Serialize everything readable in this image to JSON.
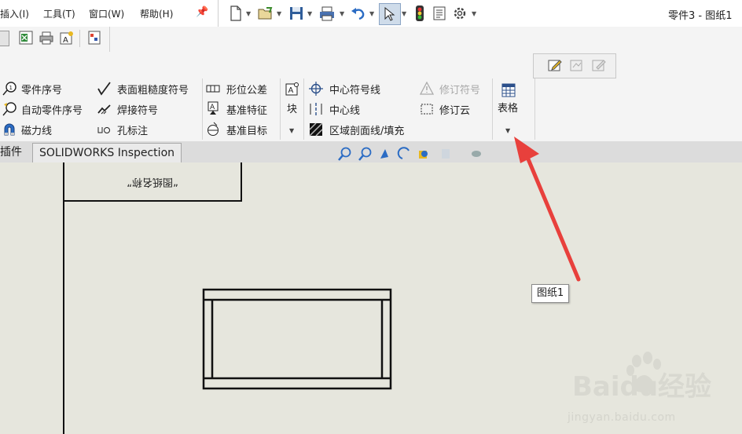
{
  "menu": {
    "insert": "插入(I)",
    "tools": "工具(T)",
    "window": "窗口(W)",
    "help": "帮助(H)"
  },
  "window_title": "零件3 - 图纸1",
  "ribbon": {
    "col1": [
      "零件序号",
      "自动零件序号",
      "磁力线"
    ],
    "col2": [
      "表面粗糙度符号",
      "焊接符号",
      "孔标注"
    ],
    "col3": [
      "形位公差",
      "基准特征",
      "基准目标"
    ],
    "block_label": "块",
    "col5": [
      "中心符号线",
      "中心线",
      "区域剖面线/填充"
    ],
    "col6": [
      "修订符号",
      "修订云"
    ],
    "table_label": "表格"
  },
  "tabs": {
    "addins": "插件",
    "inspection": "SOLIDWORKS Inspection"
  },
  "drawing": {
    "mirrored_text": "“图纸名称”"
  },
  "tooltip": "图纸1",
  "watermark": {
    "brand": "Baidu经验",
    "url": "jingyan.baidu.com"
  },
  "colors": {
    "accent_blue": "#2b6cc4",
    "arrow_red": "#e8403c",
    "canvas": "#e6e6dd"
  }
}
